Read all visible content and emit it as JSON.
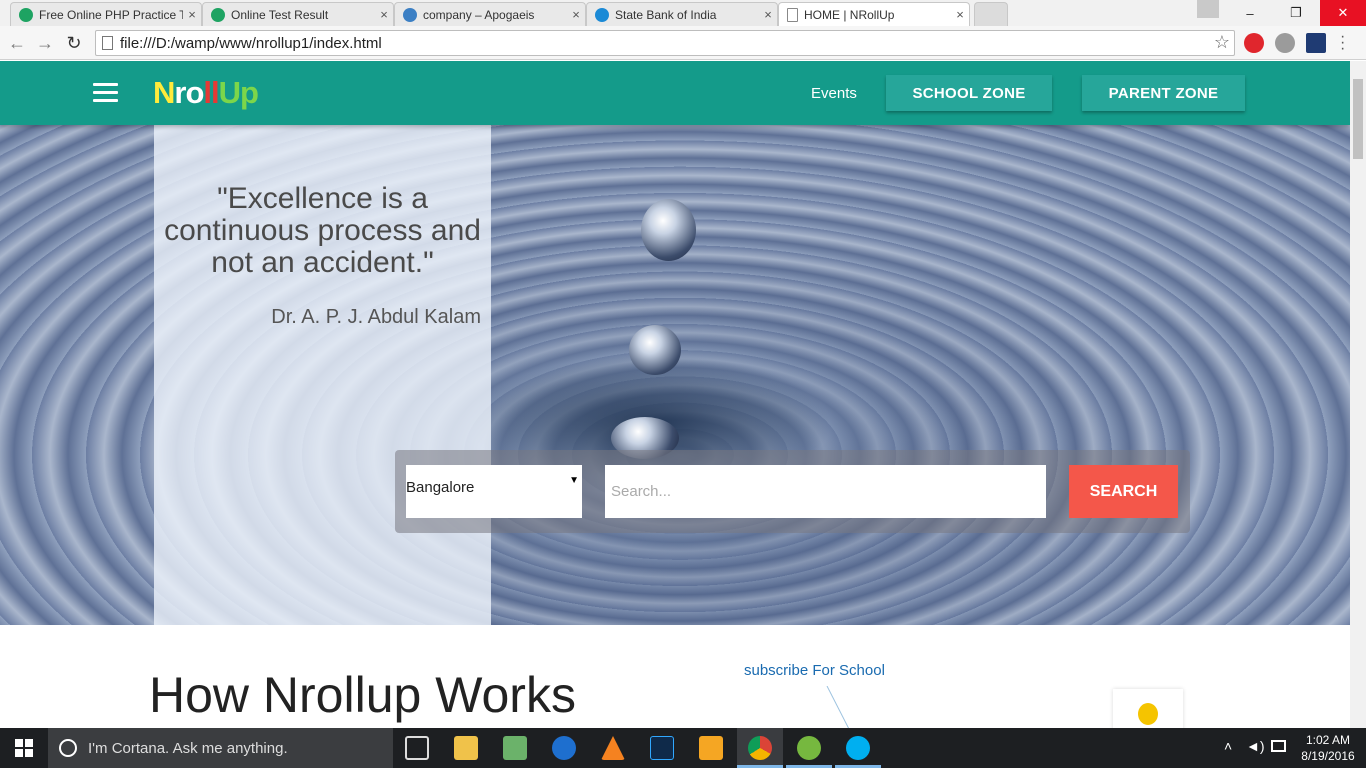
{
  "browser": {
    "tabs": [
      {
        "label": "Free Online PHP Practice T",
        "active": false,
        "icon_color": "#1ea362"
      },
      {
        "label": "Online Test Result",
        "active": false,
        "icon_color": "#1ea362"
      },
      {
        "label": "company – Apogaeis",
        "active": false,
        "icon_color": "#3b7fc4"
      },
      {
        "label": "State Bank of India",
        "active": false,
        "icon_color": "#1b8ad6"
      },
      {
        "label": "HOME | NRollUp",
        "active": true,
        "icon_color": "#ffffff"
      }
    ],
    "tab_close": "×",
    "address": "file:///D:/wamp/www/nrollup1/index.html",
    "window": {
      "minimize": "–",
      "restore": "❐",
      "close": "✕"
    }
  },
  "site": {
    "logo_letters": [
      {
        "ch": "N",
        "color": "#ffeb3b"
      },
      {
        "ch": "r",
        "color": "#ffffff"
      },
      {
        "ch": "o",
        "color": "#ffffff"
      },
      {
        "ch": "l",
        "color": "#e53935"
      },
      {
        "ch": "l",
        "color": "#e53935"
      },
      {
        "ch": "U",
        "color": "#7cd64a"
      },
      {
        "ch": "p",
        "color": "#7cd64a"
      }
    ],
    "nav": {
      "events": "Events",
      "school_zone": "SCHOOL ZONE",
      "parent_zone": "PARENT ZONE"
    },
    "hero": {
      "quote": "\"Excellence is a continuous process and not an accident.\"",
      "author": "Dr. A. P. J. Abdul Kalam"
    },
    "search": {
      "city": "Bangalore",
      "placeholder": "Search...",
      "button": "SEARCH"
    },
    "how_title": "How Nrollup Works",
    "subscribe": "subscribe For School",
    "colors": {
      "nav": "#149b8a",
      "zone_button": "#26a69a",
      "search_button": "#f4574a"
    }
  },
  "taskbar": {
    "cortana": "I'm Cortana. Ask me anything.",
    "time": "1:02 AM",
    "date": "8/19/2016"
  }
}
